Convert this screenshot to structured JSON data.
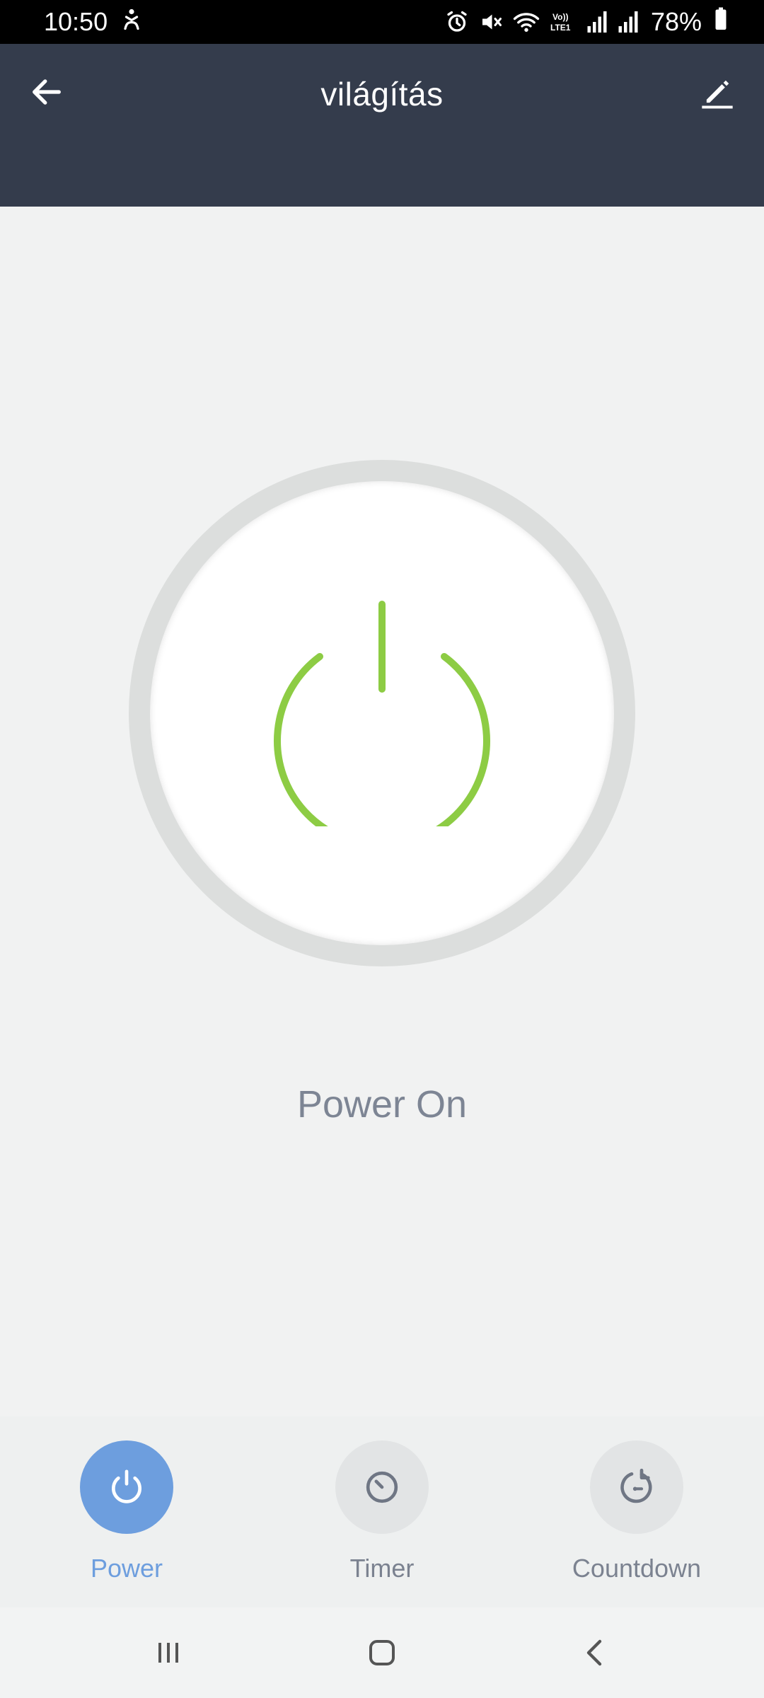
{
  "status_bar": {
    "time": "10:50",
    "battery": "78%",
    "icons": [
      "accessibility-icon",
      "alarm-icon",
      "mute-icon",
      "wifi-icon",
      "volte-icon",
      "signal-icon",
      "signal-icon-2",
      "battery-icon"
    ]
  },
  "header": {
    "title": "világítás",
    "back_icon": "arrow-left-icon",
    "edit_icon": "pencil-icon"
  },
  "power": {
    "state_label": "Power On",
    "icon": "power-icon",
    "accent_color": "#8dcc44"
  },
  "tabs": [
    {
      "label": "Power",
      "icon": "power-icon",
      "active": true
    },
    {
      "label": "Timer",
      "icon": "timer-icon",
      "active": false
    },
    {
      "label": "Countdown",
      "icon": "countdown-icon",
      "active": false
    }
  ],
  "colors": {
    "header_bg": "#343c4c",
    "active_tab": "#6d9ede",
    "inactive_tab_text": "#7b8290"
  },
  "nav_bar": {
    "icons": [
      "recents-icon",
      "home-icon",
      "back-icon"
    ]
  }
}
